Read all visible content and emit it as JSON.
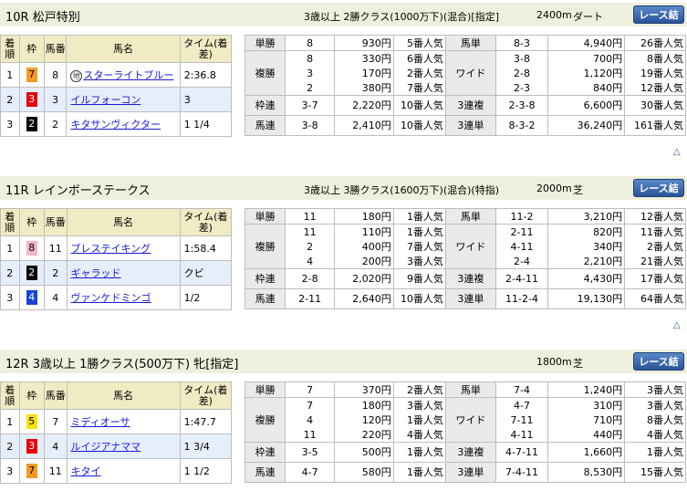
{
  "races": [
    {
      "title": "10R 松戸特別",
      "conditions": "3歳以上 2勝クラス(1000万下)(混合)[指定]",
      "distance": "2400m",
      "surface": "ダート",
      "button": "レース結果",
      "headers": {
        "rank": "着順",
        "frame": "枠",
        "num": "馬番",
        "name": "馬名",
        "time": "タイム(着差)"
      },
      "results": [
        {
          "rank": "1",
          "frame": "7",
          "frame_class": "w7",
          "num": "8",
          "mark": "地",
          "name": "スターライトブルー",
          "time": "2:36.8"
        },
        {
          "rank": "2",
          "frame": "3",
          "frame_class": "w3",
          "num": "3",
          "mark": "",
          "name": "イルフォーコン",
          "time": "3"
        },
        {
          "rank": "3",
          "frame": "2",
          "frame_class": "w2",
          "num": "2",
          "mark": "",
          "name": "キタサンヴィクター",
          "time": "1 1/4"
        }
      ],
      "payouts_left": [
        {
          "label": "単勝",
          "rows": [
            {
              "k": "8",
              "y": "930円",
              "p": "5番人気"
            }
          ]
        },
        {
          "label": "複勝",
          "rows": [
            {
              "k": "8",
              "y": "330円",
              "p": "6番人気"
            },
            {
              "k": "3",
              "y": "170円",
              "p": "2番人気"
            },
            {
              "k": "2",
              "y": "380円",
              "p": "7番人気"
            }
          ]
        },
        {
          "label": "枠連",
          "rows": [
            {
              "k": "3-7",
              "y": "2,220円",
              "p": "10番人気"
            }
          ]
        },
        {
          "label": "馬連",
          "rows": [
            {
              "k": "3-8",
              "y": "2,410円",
              "p": "10番人気"
            }
          ]
        }
      ],
      "payouts_right": [
        {
          "label": "馬単",
          "rows": [
            {
              "k": "8-3",
              "y": "4,940円",
              "p": "26番人気"
            }
          ]
        },
        {
          "label": "ワイド",
          "rows": [
            {
              "k": "3-8",
              "y": "700円",
              "p": "8番人気"
            },
            {
              "k": "2-8",
              "y": "1,120円",
              "p": "19番人気"
            },
            {
              "k": "2-3",
              "y": "840円",
              "p": "12番人気"
            }
          ]
        },
        {
          "label": "3連複",
          "rows": [
            {
              "k": "2-3-8",
              "y": "6,600円",
              "p": "30番人気"
            }
          ]
        },
        {
          "label": "3連単",
          "rows": [
            {
              "k": "8-3-2",
              "y": "36,240円",
              "p": "161番人気"
            }
          ]
        }
      ],
      "up_icon": "△"
    },
    {
      "title": "11R レインボーステークス",
      "conditions": "3歳以上 3勝クラス(1600万下)(混合)(特指)",
      "distance": "2000m",
      "surface": "芝",
      "button": "レース結果",
      "headers": {
        "rank": "着順",
        "frame": "枠",
        "num": "馬番",
        "name": "馬名",
        "time": "タイム(着差)"
      },
      "results": [
        {
          "rank": "1",
          "frame": "8",
          "frame_class": "w8",
          "num": "11",
          "mark": "",
          "name": "ブレステイキング",
          "time": "1:58.4"
        },
        {
          "rank": "2",
          "frame": "2",
          "frame_class": "w2",
          "num": "2",
          "mark": "",
          "name": "ギャラッド",
          "time": "クビ"
        },
        {
          "rank": "3",
          "frame": "4",
          "frame_class": "w4",
          "num": "4",
          "mark": "",
          "name": "ヴァンケドミンゴ",
          "time": "1/2"
        }
      ],
      "payouts_left": [
        {
          "label": "単勝",
          "rows": [
            {
              "k": "11",
              "y": "180円",
              "p": "1番人気"
            }
          ]
        },
        {
          "label": "複勝",
          "rows": [
            {
              "k": "11",
              "y": "110円",
              "p": "1番人気"
            },
            {
              "k": "2",
              "y": "400円",
              "p": "7番人気"
            },
            {
              "k": "4",
              "y": "200円",
              "p": "3番人気"
            }
          ]
        },
        {
          "label": "枠連",
          "rows": [
            {
              "k": "2-8",
              "y": "2,020円",
              "p": "9番人気"
            }
          ]
        },
        {
          "label": "馬連",
          "rows": [
            {
              "k": "2-11",
              "y": "2,640円",
              "p": "10番人気"
            }
          ]
        }
      ],
      "payouts_right": [
        {
          "label": "馬単",
          "rows": [
            {
              "k": "11-2",
              "y": "3,210円",
              "p": "12番人気"
            }
          ]
        },
        {
          "label": "ワイド",
          "rows": [
            {
              "k": "2-11",
              "y": "820円",
              "p": "11番人気"
            },
            {
              "k": "4-11",
              "y": "340円",
              "p": "2番人気"
            },
            {
              "k": "2-4",
              "y": "2,210円",
              "p": "21番人気"
            }
          ]
        },
        {
          "label": "3連複",
          "rows": [
            {
              "k": "2-4-11",
              "y": "4,430円",
              "p": "17番人気"
            }
          ]
        },
        {
          "label": "3連単",
          "rows": [
            {
              "k": "11-2-4",
              "y": "19,130円",
              "p": "64番人気"
            }
          ]
        }
      ],
      "up_icon": "△"
    },
    {
      "title": "12R 3歳以上 1勝クラス(500万下) 牝[指定]",
      "conditions": "",
      "distance": "1800m",
      "surface": "芝",
      "button": "レース結果",
      "headers": {
        "rank": "着順",
        "frame": "枠",
        "num": "馬番",
        "name": "馬名",
        "time": "タイム(着差)"
      },
      "results": [
        {
          "rank": "1",
          "frame": "5",
          "frame_class": "w5",
          "num": "7",
          "mark": "",
          "name": "ミディオーサ",
          "time": "1:47.7"
        },
        {
          "rank": "2",
          "frame": "3",
          "frame_class": "w3",
          "num": "4",
          "mark": "",
          "name": "ルイジアナママ",
          "time": "1 3/4"
        },
        {
          "rank": "3",
          "frame": "7",
          "frame_class": "w7",
          "num": "11",
          "mark": "",
          "name": "キタイ",
          "time": "1 1/2"
        }
      ],
      "payouts_left": [
        {
          "label": "単勝",
          "rows": [
            {
              "k": "7",
              "y": "370円",
              "p": "2番人気"
            }
          ]
        },
        {
          "label": "複勝",
          "rows": [
            {
              "k": "7",
              "y": "180円",
              "p": "3番人気"
            },
            {
              "k": "4",
              "y": "120円",
              "p": "1番人気"
            },
            {
              "k": "11",
              "y": "220円",
              "p": "4番人気"
            }
          ]
        },
        {
          "label": "枠連",
          "rows": [
            {
              "k": "3-5",
              "y": "500円",
              "p": "1番人気"
            }
          ]
        },
        {
          "label": "馬連",
          "rows": [
            {
              "k": "4-7",
              "y": "580円",
              "p": "1番人気"
            }
          ]
        }
      ],
      "payouts_right": [
        {
          "label": "馬単",
          "rows": [
            {
              "k": "7-4",
              "y": "1,240円",
              "p": "3番人気"
            }
          ]
        },
        {
          "label": "ワイド",
          "rows": [
            {
              "k": "4-7",
              "y": "310円",
              "p": "3番人気"
            },
            {
              "k": "7-11",
              "y": "710円",
              "p": "8番人気"
            },
            {
              "k": "4-11",
              "y": "440円",
              "p": "4番人気"
            }
          ]
        },
        {
          "label": "3連複",
          "rows": [
            {
              "k": "4-7-11",
              "y": "1,660円",
              "p": "1番人気"
            }
          ]
        },
        {
          "label": "3連単",
          "rows": [
            {
              "k": "7-4-11",
              "y": "8,530円",
              "p": "15番人気"
            }
          ]
        }
      ],
      "up_icon": ""
    }
  ]
}
